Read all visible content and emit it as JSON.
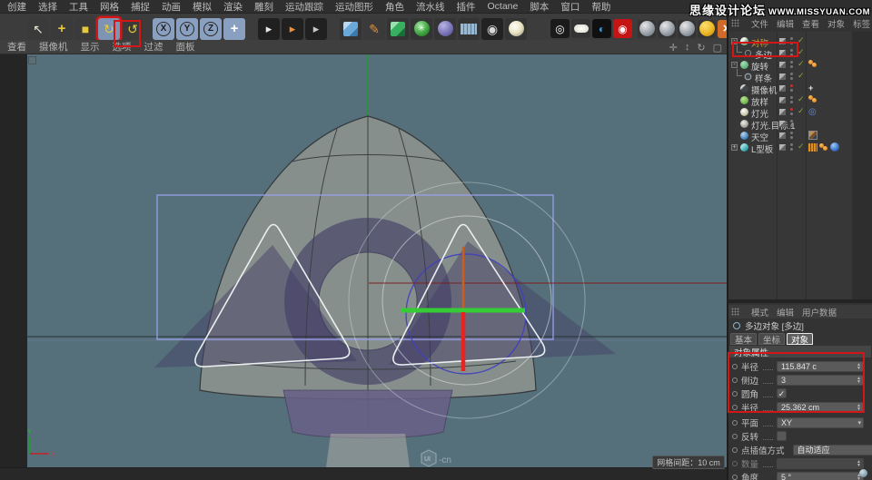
{
  "watermark": {
    "site_name": "思缘设计论坛",
    "site_url": "WWW.MISSYUAN.COM"
  },
  "menubar": {
    "items": [
      "创建",
      "选择",
      "工具",
      "网格",
      "捕捉",
      "动画",
      "模拟",
      "渲染",
      "雕刻",
      "运动跟踪",
      "运动图形",
      "角色",
      "流水线",
      "插件",
      "Octane",
      "脚本",
      "窗口",
      "帮助"
    ]
  },
  "toolbar": {
    "icons": [
      {
        "name": "live-selection",
        "glyph": "↖",
        "fg": "#e8e4d8",
        "bg": "#3a3a3a",
        "gap": 0
      },
      {
        "name": "move-tool",
        "glyph": "+",
        "fg": "#e8c83c",
        "bg": "#3a3a3a",
        "bold": true,
        "gap": 2
      },
      {
        "name": "scale-tool",
        "glyph": "■",
        "fg": "#e8c83c",
        "bg": "#3a3a3a",
        "gap": 2
      },
      {
        "name": "rotate-tool",
        "glyph": "↻",
        "fg": "#e8c83c",
        "bg": "#7e94b4",
        "selected": true,
        "redbox": true,
        "gap": 2
      },
      {
        "name": "last-tool",
        "glyph": "↺",
        "fg": "#e8c83c",
        "bg": "#3a3a3a",
        "gap": 2
      },
      {
        "name": "lock-x-axis",
        "letter": "X",
        "kind": "axis",
        "gap": 10
      },
      {
        "name": "lock-y-axis",
        "letter": "Y",
        "kind": "axis",
        "gap": 2
      },
      {
        "name": "lock-z-axis",
        "letter": "Z",
        "kind": "axis",
        "gap": 2
      },
      {
        "name": "coordinate-system",
        "glyph": "+",
        "fg": "#ffffff",
        "bg": "#8aa0c0",
        "bold": true,
        "gap": 2
      },
      {
        "name": "render-view",
        "glyph": "▸",
        "fg": "#e8e8e8",
        "bg": "#202020",
        "clap": true,
        "gap": 14
      },
      {
        "name": "render-region",
        "glyph": "▸",
        "fg": "#e8903c",
        "bg": "#202020",
        "clap": true,
        "gap": 2
      },
      {
        "name": "render-settings",
        "glyph": "▸",
        "fg": "#c8c8c8",
        "bg": "#202020",
        "clap": true,
        "gap": 2
      },
      {
        "name": "add-primitive-cube",
        "kind": "cube-blue",
        "gap": 14
      },
      {
        "name": "pen-spline",
        "glyph": "✎",
        "fg": "#e0903a",
        "bg": "#3a3a3a",
        "gap": 2
      },
      {
        "name": "subdivision-surface",
        "kind": "cube-green",
        "gap": 2
      },
      {
        "name": "mograph-array",
        "kind": "ball-green",
        "glyph": "✳",
        "fg": "#e8ffe8",
        "gap": 2
      },
      {
        "name": "deformer",
        "kind": "ball-purple",
        "gap": 2
      },
      {
        "name": "floor-environment",
        "kind": "grid-floor",
        "gap": 2
      },
      {
        "name": "scene-camera",
        "glyph": "◉",
        "fg": "#d8d8d8",
        "bg": "#222222",
        "gap": 2
      },
      {
        "name": "scene-light",
        "kind": "ball-light",
        "gap": 2
      },
      {
        "name": "target-material",
        "glyph": "◎",
        "fg": "#ffffff",
        "bg": "#1a1a1a",
        "small": true,
        "gap": 26
      },
      {
        "name": "material-white",
        "kind": "pill-white",
        "small": true,
        "gap": 2
      },
      {
        "name": "material-contrast",
        "glyph": "◐",
        "fg": "#3d9ad6",
        "bg": "#101010",
        "small": true,
        "gap": 2
      },
      {
        "name": "render-camera",
        "glyph": "◉",
        "fg": "#ffffff",
        "bg": "#c41414",
        "small": true,
        "gap": 2
      },
      {
        "name": "material-sphere-1",
        "kind": "ball-gray",
        "xsmall": true,
        "gap": 6
      },
      {
        "name": "material-sphere-2",
        "kind": "ball-gray",
        "xsmall": true,
        "gap": 2
      },
      {
        "name": "material-sphere-3",
        "kind": "ball-gray",
        "xsmall": true,
        "gap": 2
      },
      {
        "name": "coords-xyz",
        "kind": "ball-yellow",
        "xsmall": true,
        "gap": 2
      },
      {
        "name": "axis-modify",
        "glyph": "×",
        "fg": "#ffffff",
        "bg": "#d06a28",
        "bold": true,
        "xsmall": true,
        "gap": 2
      },
      {
        "name": "snap-tool",
        "kind": "snap",
        "xsmall": true,
        "gap": 2
      }
    ]
  },
  "viewport": {
    "menu_items": [
      "查看",
      "摄像机",
      "显示",
      "选项",
      "过滤",
      "面板"
    ],
    "nav_icons": [
      {
        "name": "pan-view",
        "glyph": "✛"
      },
      {
        "name": "zoom-view",
        "glyph": "↕"
      },
      {
        "name": "rotate-view",
        "glyph": "↻"
      },
      {
        "name": "maximize-view",
        "glyph": "▢"
      }
    ],
    "grid_label": "网格间距：10 cm",
    "logo_text": "UI",
    "logo_suffix": "-cn",
    "axis_x_label": "X",
    "axis_y_label": "Y"
  },
  "object_manager": {
    "menu": [
      "文件",
      "编辑",
      "查看",
      "对象",
      "标签"
    ],
    "items": [
      {
        "label": "对称",
        "icon_color": "linear-gradient(135deg,#e8f0e8 40%,#88a890 60%)",
        "expand": "-",
        "label_color": "#c89b46",
        "check": true,
        "tags": []
      },
      {
        "label": "多边",
        "icon_color": "radial-gradient(circle,#3a3a3a 40%,#bbbbbb 48%,#3a3a3a 58%)",
        "child": true,
        "check": true,
        "tags": []
      },
      {
        "label": "旋转",
        "icon_color": "radial-gradient(circle at 35% 30%,#a8e0b8,#3a9858)",
        "expand": "-",
        "check": true,
        "tags": [
          "phong"
        ]
      },
      {
        "label": "样条",
        "icon_color": "radial-gradient(circle,#44484a 40%,#c8d0d4 50%,#44484a 62%)",
        "child": true,
        "check": true,
        "tags": []
      },
      {
        "label": "摄像机",
        "icon_color": "linear-gradient(135deg,#d8d8d8 30%,#404448 40%)",
        "top_red": true,
        "check": false,
        "tags": [
          "cross"
        ]
      },
      {
        "label": "放样",
        "icon_color": "radial-gradient(circle at 35% 30%,#b8e890,#4a9830)",
        "check": true,
        "tags": [
          "phong"
        ]
      },
      {
        "label": "灯光",
        "icon_color": "radial-gradient(circle at 40% 35%,#ffffff,#c8c4a8 60%,#706c58)",
        "top_red": true,
        "check": true,
        "tags": [
          "targetblue"
        ]
      },
      {
        "label": "灯光.目标.1",
        "icon_color": "radial-gradient(circle at 40% 35%,#f0f0ee,#a8a49a 60%,#5c5850)",
        "check": false,
        "tags": []
      },
      {
        "label": "天空",
        "icon_color": "radial-gradient(circle at 35% 30%,#bcd8f0,#4a88c0 60%,#1c4880)",
        "check": false,
        "tags": [
          "texture"
        ]
      },
      {
        "label": "L型板",
        "icon_color": "linear-gradient(135deg,#9adfe0 30%,#38a8b0 70%,#1a6870)",
        "expand": "+",
        "check": true,
        "tags": [
          "uv",
          "phong",
          "ballblue"
        ]
      }
    ]
  },
  "attributes": {
    "menu": [
      "模式",
      "编辑",
      "用户数据"
    ],
    "object_title": "多边对象 [多边]",
    "tabs": [
      "基本",
      "坐标",
      "对象"
    ],
    "active_tab_index": 2,
    "section_title": "对象属性",
    "check_glyph": "✓",
    "stepper_up": "▲",
    "stepper_down": "▼",
    "dropdown_glyph": "▾",
    "rows": [
      {
        "label": "半径",
        "type": "value",
        "value": "115.847 c",
        "stepper": true
      },
      {
        "label": "侧边",
        "type": "value",
        "value": "3",
        "stepper": true
      },
      {
        "label": "圆角",
        "type": "checkbox",
        "checked": true
      },
      {
        "label": "半径",
        "type": "value",
        "value": "25.362 cm",
        "stepper": true
      },
      {
        "label": "平面",
        "type": "dropdown",
        "value": "XY"
      },
      {
        "label": "反转",
        "type": "checkbox",
        "checked": false
      },
      {
        "label": "点插值方式",
        "type": "dropdown",
        "value": "自动适应"
      },
      {
        "label": "数量",
        "type": "value",
        "value": "",
        "stepper": true,
        "disabled": true
      },
      {
        "label": "角度",
        "type": "value",
        "value": "5 °",
        "stepper": true
      }
    ]
  },
  "colors": {
    "annotation_red": "#d51616",
    "viewport_bg": "#55707a",
    "gizmo_green": "#35cc35",
    "gizmo_red": "#e92222",
    "gizmo_orange": "#cc5c20",
    "selection_blue": "#97a0e8"
  }
}
